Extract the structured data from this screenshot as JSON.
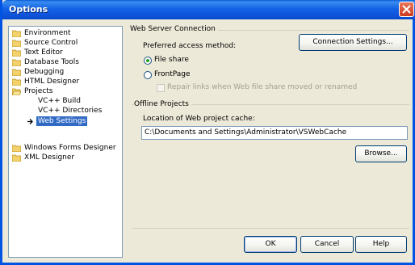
{
  "window": {
    "title": "Options"
  },
  "tree": {
    "items": [
      {
        "label": "Environment",
        "folder": true
      },
      {
        "label": "Source Control",
        "folder": true
      },
      {
        "label": "Text Editor",
        "folder": true
      },
      {
        "label": "Database Tools",
        "folder": true
      },
      {
        "label": "Debugging",
        "folder": true
      },
      {
        "label": "HTML Designer",
        "folder": true
      },
      {
        "label": "Projects",
        "folder": true,
        "expanded": true
      },
      {
        "label": "VC++ Build",
        "folder": false
      },
      {
        "label": "VC++ Directories",
        "folder": false
      },
      {
        "label": "Web Settings",
        "folder": false,
        "selected": true
      },
      {
        "label": "Windows Forms Designer",
        "folder": true
      },
      {
        "label": "XML Designer",
        "folder": true
      }
    ]
  },
  "web_server": {
    "group_title": "Web Server Connection",
    "preferred_label": "Preferred access method:",
    "connection_settings_button": "Connection Settings...",
    "file_share_label": "File share",
    "frontpage_label": "FrontPage",
    "repair_links_label": "Repair links when Web file share moved or renamed",
    "selected_method": "File share"
  },
  "offline": {
    "group_title": "Offline Projects",
    "location_label": "Location of Web project cache:",
    "cache_path": "C:\\Documents and Settings\\Administrator\\VSWebCache",
    "browse_button": "Browse..."
  },
  "footer": {
    "ok": "OK",
    "cancel": "Cancel",
    "help": "Help"
  },
  "colors": {
    "titlebar": "#0b4fd6",
    "selection": "#316ac5",
    "dialog_bg": "#ece9d8"
  }
}
